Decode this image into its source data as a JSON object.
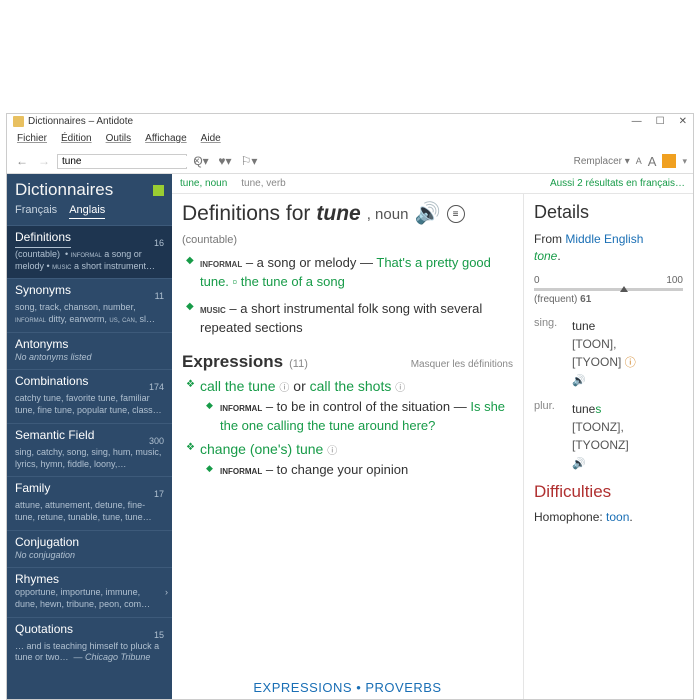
{
  "window": {
    "title": "Dictionnaires – Antidote"
  },
  "menu": {
    "fichier": "Fichier",
    "edition": "Édition",
    "outils": "Outils",
    "affichage": "Affichage",
    "aide": "Aide"
  },
  "toolbar": {
    "search_value": "tune",
    "remplacer": "Remplacer"
  },
  "sidebar": {
    "title": "Dictionnaires",
    "tabs": {
      "fr": "Français",
      "en": "Anglais"
    },
    "sections": [
      {
        "title": "Definitions",
        "count": "16",
        "sub_html": "(countable) • ɪɴғᴏʀᴍᴀʟ a song or melody • ᴍᴜsɪᴄ a short instrument…"
      },
      {
        "title": "Synonyms",
        "count": "11",
        "sub": "song, track, chanson, number, ɪɴғᴏʀᴍᴀʟ ditty, earworm, US, CAN, SL…"
      },
      {
        "title": "Antonyms",
        "count": "",
        "sub": "No antonyms listed"
      },
      {
        "title": "Combinations",
        "count": "174",
        "sub": "catchy tune, favorite tune, familiar tune, fine tune, popular tune, class…"
      },
      {
        "title": "Semantic Field",
        "count": "300",
        "sub": "sing, catchy, song, sing, hum, music, lyrics, hymn, fiddle, loony,…"
      },
      {
        "title": "Family",
        "count": "17",
        "sub": "attune, attunement, detune, fine-tune, retune, tunable, tune, tune…"
      },
      {
        "title": "Conjugation",
        "count": "",
        "sub": "No conjugation"
      },
      {
        "title": "Rhymes",
        "count": "",
        "sub": "opportune, importune, immune, dune, hewn, tribune, peon, com…"
      },
      {
        "title": "Quotations",
        "count": "15",
        "sub": "… and is teaching himself to pluck a tune or two… — Chicago Tribune"
      }
    ]
  },
  "senses": {
    "tab1": "tune, noun",
    "tab2": "tune, verb",
    "also": "Aussi 2 résultats en français…"
  },
  "article": {
    "heading_pre": "Definitions for ",
    "headword": "tune",
    "pos": ", noun",
    "countable": "(countable)",
    "sense1_tag": "informal",
    "sense1_def": " – a song or melody — ",
    "sense1_ex": "That's a pretty good tune. ▫ the tune of a song",
    "sense2_tag": "music",
    "sense2_def": " – a short instrumental folk song with several repeated sections",
    "expr_title": "Expressions",
    "expr_count": "(11)",
    "expr_mask": "Masquer les définitions",
    "expr1_a": "call the tune",
    "expr1_or": " or ",
    "expr1_b": "call the shots",
    "expr1_sub_tag": "informal",
    "expr1_sub_def": " – to be in control of the situation — ",
    "expr1_sub_ex": "Is she the one calling the tune around here?",
    "expr2": "change (one's) tune",
    "expr2_sub_tag": "informal",
    "expr2_sub_def": " – to change your opinion",
    "bottom": "EXPRESSIONS • PROVERBS"
  },
  "details": {
    "title": "Details",
    "from": "From ",
    "me": "Middle English",
    "tone": "tone",
    "dot": ".",
    "freq_min": "0",
    "freq_max": "100",
    "freq_label": "(frequent) ",
    "freq_val": "61",
    "sing_label": "sing.",
    "sing_form": "tune",
    "sing_ph1": "[TOON],",
    "sing_ph2": "[TYOON]",
    "plur_label": "plur.",
    "plur_form": "tune",
    "plur_suf": "s",
    "plur_ph1": "[TOONZ],",
    "plur_ph2": "[TYOONZ]",
    "diff_title": "Difficulties",
    "diff_label": "Homophone: ",
    "diff_word": "toon",
    "diff_dot": "."
  }
}
